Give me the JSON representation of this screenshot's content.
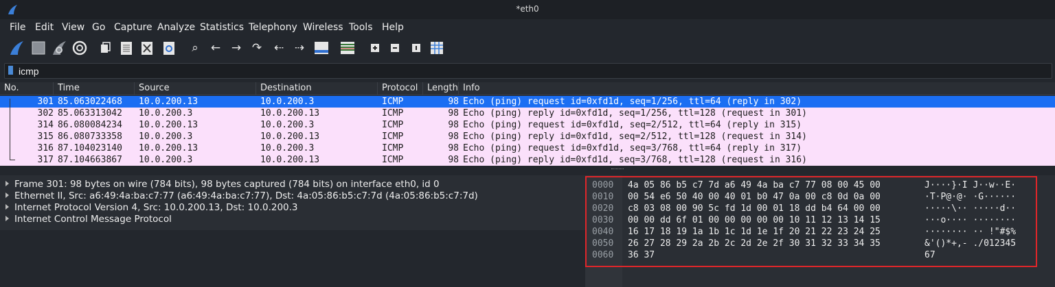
{
  "window": {
    "title": "*eth0"
  },
  "menu": [
    "File",
    "Edit",
    "View",
    "Go",
    "Capture",
    "Analyze",
    "Statistics",
    "Telephony",
    "Wireless",
    "Tools",
    "Help"
  ],
  "toolbar": {
    "icons": [
      "start-capture-icon",
      "stop-capture-icon",
      "restart-capture-icon",
      "capture-options-icon",
      "open-file-icon",
      "save-file-icon",
      "close-file-icon",
      "reload-file-icon",
      "find-packet-icon",
      "go-back-icon",
      "go-forward-icon",
      "go-to-packet-icon",
      "first-packet-icon",
      "last-packet-icon",
      "auto-scroll-icon",
      "colorize-icon",
      "zoom-in-icon",
      "zoom-out-icon",
      "normal-size-icon",
      "resize-columns-icon"
    ]
  },
  "filter": {
    "value": "icmp"
  },
  "columns": {
    "no": "No.",
    "time": "Time",
    "source": "Source",
    "destination": "Destination",
    "protocol": "Protocol",
    "length": "Length",
    "info": "Info"
  },
  "packets": [
    {
      "no": "301",
      "time": "85.063022468",
      "source": "10.0.200.13",
      "destination": "10.0.200.3",
      "protocol": "ICMP",
      "length": "98",
      "info": "Echo (ping) request  id=0xfd1d, seq=1/256, ttl=64 (reply in 302)"
    },
    {
      "no": "302",
      "time": "85.063313042",
      "source": "10.0.200.3",
      "destination": "10.0.200.13",
      "protocol": "ICMP",
      "length": "98",
      "info": "Echo (ping) reply    id=0xfd1d, seq=1/256, ttl=128 (request in 301)"
    },
    {
      "no": "314",
      "time": "86.080084234",
      "source": "10.0.200.13",
      "destination": "10.0.200.3",
      "protocol": "ICMP",
      "length": "98",
      "info": "Echo (ping) request  id=0xfd1d, seq=2/512, ttl=64 (reply in 315)"
    },
    {
      "no": "315",
      "time": "86.080733358",
      "source": "10.0.200.3",
      "destination": "10.0.200.13",
      "protocol": "ICMP",
      "length": "98",
      "info": "Echo (ping) reply    id=0xfd1d, seq=2/512, ttl=128 (request in 314)"
    },
    {
      "no": "316",
      "time": "87.104023140",
      "source": "10.0.200.13",
      "destination": "10.0.200.3",
      "protocol": "ICMP",
      "length": "98",
      "info": "Echo (ping) request  id=0xfd1d, seq=3/768, ttl=64 (reply in 317)"
    },
    {
      "no": "317",
      "time": "87.104663867",
      "source": "10.0.200.3",
      "destination": "10.0.200.13",
      "protocol": "ICMP",
      "length": "98",
      "info": "Echo (ping) reply    id=0xfd1d, seq=3/768, ttl=128 (request in 316)"
    }
  ],
  "details": [
    "Frame 301: 98 bytes on wire (784 bits), 98 bytes captured (784 bits) on interface eth0, id 0",
    "Ethernet II, Src: a6:49:4a:ba:c7:77 (a6:49:4a:ba:c7:77), Dst: 4a:05:86:b5:c7:7d (4a:05:86:b5:c7:7d)",
    "Internet Protocol Version 4, Src: 10.0.200.13, Dst: 10.0.200.3",
    "Internet Control Message Protocol"
  ],
  "bytes": [
    {
      "offset": "0000",
      "hex": "4a 05 86 b5 c7 7d a6 49  4a ba c7 77 08 00 45 00",
      "ascii": "J····}·I J··w··E·"
    },
    {
      "offset": "0010",
      "hex": "00 54 e6 50 40 00 40 01  b0 47 0a 00 c8 0d 0a 00",
      "ascii": "·T·P@·@· ·G······"
    },
    {
      "offset": "0020",
      "hex": "c8 03 08 00 90 5c fd 1d  00 01 18 dd b4 64 00 00",
      "ascii": "·····\\·· ·····d··"
    },
    {
      "offset": "0030",
      "hex": "00 00 dd 6f 01 00 00 00  00 00 10 11 12 13 14 15",
      "ascii": "···o···· ········"
    },
    {
      "offset": "0040",
      "hex": "16 17 18 19 1a 1b 1c 1d  1e 1f 20 21 22 23 24 25",
      "ascii": "········ ·· !\"#$%"
    },
    {
      "offset": "0050",
      "hex": "26 27 28 29 2a 2b 2c 2d  2e 2f 30 31 32 33 34 35",
      "ascii": "&'()*+,- ./012345"
    },
    {
      "offset": "0060",
      "hex": "36 37",
      "ascii": "67"
    }
  ],
  "colors": {
    "selected_row": "#1b6ef3",
    "icmp_row": "#fbe0fb",
    "highlight_box": "#e0262a",
    "background": "#23272d"
  }
}
